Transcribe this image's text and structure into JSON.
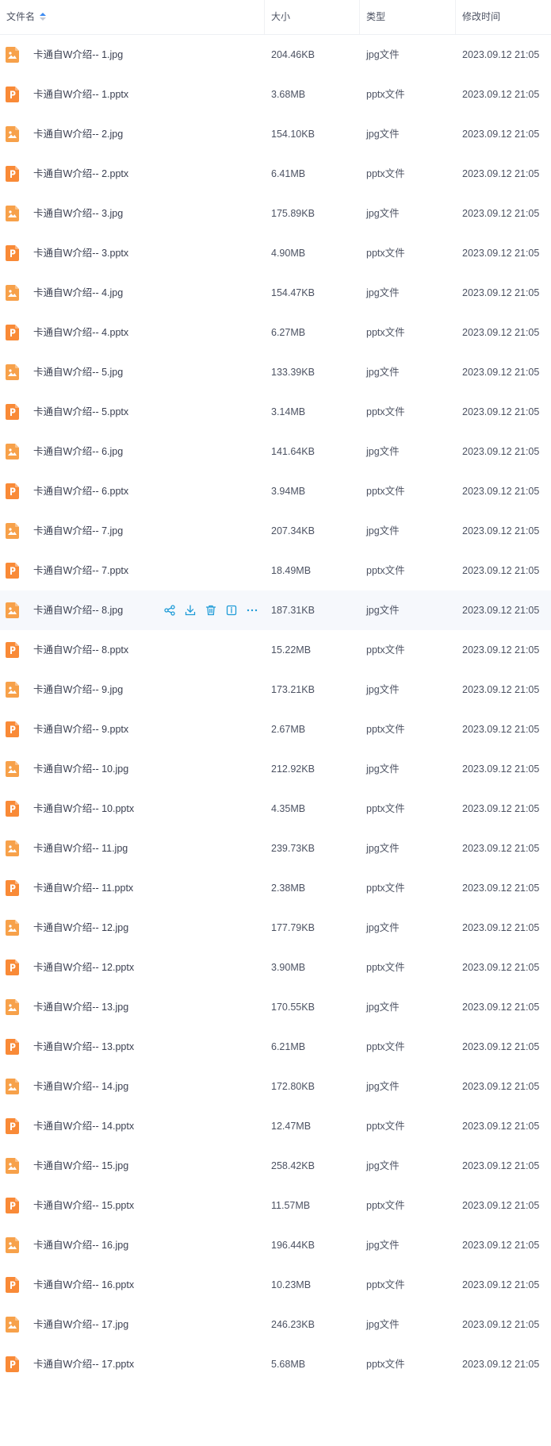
{
  "header": {
    "name_label": "文件名",
    "size_label": "大小",
    "type_label": "类型",
    "time_label": "修改时间"
  },
  "colors": {
    "jpg_icon": "#f7a14a",
    "pptx_icon": "#f98a37",
    "action_blue": "#1e9bd7",
    "sort_blue": "#3d8bf2",
    "hover_bg": "#f6f8fc"
  },
  "hover_actions": [
    "share-icon",
    "download-icon",
    "delete-icon",
    "info-icon",
    "more-icon"
  ],
  "files": [
    {
      "name": "卡通自W介绍-- 1.jpg",
      "size": "204.46KB",
      "type": "jpg文件",
      "time": "2023.09.12 21:05",
      "kind": "jpg"
    },
    {
      "name": "卡通自W介绍-- 1.pptx",
      "size": "3.68MB",
      "type": "pptx文件",
      "time": "2023.09.12 21:05",
      "kind": "pptx"
    },
    {
      "name": "卡通自W介绍-- 2.jpg",
      "size": "154.10KB",
      "type": "jpg文件",
      "time": "2023.09.12 21:05",
      "kind": "jpg"
    },
    {
      "name": "卡通自W介绍-- 2.pptx",
      "size": "6.41MB",
      "type": "pptx文件",
      "time": "2023.09.12 21:05",
      "kind": "pptx"
    },
    {
      "name": "卡通自W介绍-- 3.jpg",
      "size": "175.89KB",
      "type": "jpg文件",
      "time": "2023.09.12 21:05",
      "kind": "jpg"
    },
    {
      "name": "卡通自W介绍-- 3.pptx",
      "size": "4.90MB",
      "type": "pptx文件",
      "time": "2023.09.12 21:05",
      "kind": "pptx"
    },
    {
      "name": "卡通自W介绍-- 4.jpg",
      "size": "154.47KB",
      "type": "jpg文件",
      "time": "2023.09.12 21:05",
      "kind": "jpg"
    },
    {
      "name": "卡通自W介绍-- 4.pptx",
      "size": "6.27MB",
      "type": "pptx文件",
      "time": "2023.09.12 21:05",
      "kind": "pptx"
    },
    {
      "name": "卡通自W介绍-- 5.jpg",
      "size": "133.39KB",
      "type": "jpg文件",
      "time": "2023.09.12 21:05",
      "kind": "jpg"
    },
    {
      "name": "卡通自W介绍-- 5.pptx",
      "size": "3.14MB",
      "type": "pptx文件",
      "time": "2023.09.12 21:05",
      "kind": "pptx"
    },
    {
      "name": "卡通自W介绍-- 6.jpg",
      "size": "141.64KB",
      "type": "jpg文件",
      "time": "2023.09.12 21:05",
      "kind": "jpg"
    },
    {
      "name": "卡通自W介绍-- 6.pptx",
      "size": "3.94MB",
      "type": "pptx文件",
      "time": "2023.09.12 21:05",
      "kind": "pptx"
    },
    {
      "name": "卡通自W介绍-- 7.jpg",
      "size": "207.34KB",
      "type": "jpg文件",
      "time": "2023.09.12 21:05",
      "kind": "jpg"
    },
    {
      "name": "卡通自W介绍-- 7.pptx",
      "size": "18.49MB",
      "type": "pptx文件",
      "time": "2023.09.12 21:05",
      "kind": "pptx"
    },
    {
      "name": "卡通自W介绍-- 8.jpg",
      "size": "187.31KB",
      "type": "jpg文件",
      "time": "2023.09.12 21:05",
      "kind": "jpg",
      "hovered": true
    },
    {
      "name": "卡通自W介绍-- 8.pptx",
      "size": "15.22MB",
      "type": "pptx文件",
      "time": "2023.09.12 21:05",
      "kind": "pptx"
    },
    {
      "name": "卡通自W介绍-- 9.jpg",
      "size": "173.21KB",
      "type": "jpg文件",
      "time": "2023.09.12 21:05",
      "kind": "jpg"
    },
    {
      "name": "卡通自W介绍-- 9.pptx",
      "size": "2.67MB",
      "type": "pptx文件",
      "time": "2023.09.12 21:05",
      "kind": "pptx"
    },
    {
      "name": "卡通自W介绍-- 10.jpg",
      "size": "212.92KB",
      "type": "jpg文件",
      "time": "2023.09.12 21:05",
      "kind": "jpg"
    },
    {
      "name": "卡通自W介绍-- 10.pptx",
      "size": "4.35MB",
      "type": "pptx文件",
      "time": "2023.09.12 21:05",
      "kind": "pptx"
    },
    {
      "name": "卡通自W介绍-- 11.jpg",
      "size": "239.73KB",
      "type": "jpg文件",
      "time": "2023.09.12 21:05",
      "kind": "jpg"
    },
    {
      "name": "卡通自W介绍-- 11.pptx",
      "size": "2.38MB",
      "type": "pptx文件",
      "time": "2023.09.12 21:05",
      "kind": "pptx"
    },
    {
      "name": "卡通自W介绍-- 12.jpg",
      "size": "177.79KB",
      "type": "jpg文件",
      "time": "2023.09.12 21:05",
      "kind": "jpg"
    },
    {
      "name": "卡通自W介绍-- 12.pptx",
      "size": "3.90MB",
      "type": "pptx文件",
      "time": "2023.09.12 21:05",
      "kind": "pptx"
    },
    {
      "name": "卡通自W介绍-- 13.jpg",
      "size": "170.55KB",
      "type": "jpg文件",
      "time": "2023.09.12 21:05",
      "kind": "jpg"
    },
    {
      "name": "卡通自W介绍-- 13.pptx",
      "size": "6.21MB",
      "type": "pptx文件",
      "time": "2023.09.12 21:05",
      "kind": "pptx"
    },
    {
      "name": "卡通自W介绍-- 14.jpg",
      "size": "172.80KB",
      "type": "jpg文件",
      "time": "2023.09.12 21:05",
      "kind": "jpg"
    },
    {
      "name": "卡通自W介绍-- 14.pptx",
      "size": "12.47MB",
      "type": "pptx文件",
      "time": "2023.09.12 21:05",
      "kind": "pptx"
    },
    {
      "name": "卡通自W介绍-- 15.jpg",
      "size": "258.42KB",
      "type": "jpg文件",
      "time": "2023.09.12 21:05",
      "kind": "jpg"
    },
    {
      "name": "卡通自W介绍-- 15.pptx",
      "size": "11.57MB",
      "type": "pptx文件",
      "time": "2023.09.12 21:05",
      "kind": "pptx"
    },
    {
      "name": "卡通自W介绍-- 16.jpg",
      "size": "196.44KB",
      "type": "jpg文件",
      "time": "2023.09.12 21:05",
      "kind": "jpg"
    },
    {
      "name": "卡通自W介绍-- 16.pptx",
      "size": "10.23MB",
      "type": "pptx文件",
      "time": "2023.09.12 21:05",
      "kind": "pptx"
    },
    {
      "name": "卡通自W介绍-- 17.jpg",
      "size": "246.23KB",
      "type": "jpg文件",
      "time": "2023.09.12 21:05",
      "kind": "jpg"
    },
    {
      "name": "卡通自W介绍-- 17.pptx",
      "size": "5.68MB",
      "type": "pptx文件",
      "time": "2023.09.12 21:05",
      "kind": "pptx"
    }
  ]
}
